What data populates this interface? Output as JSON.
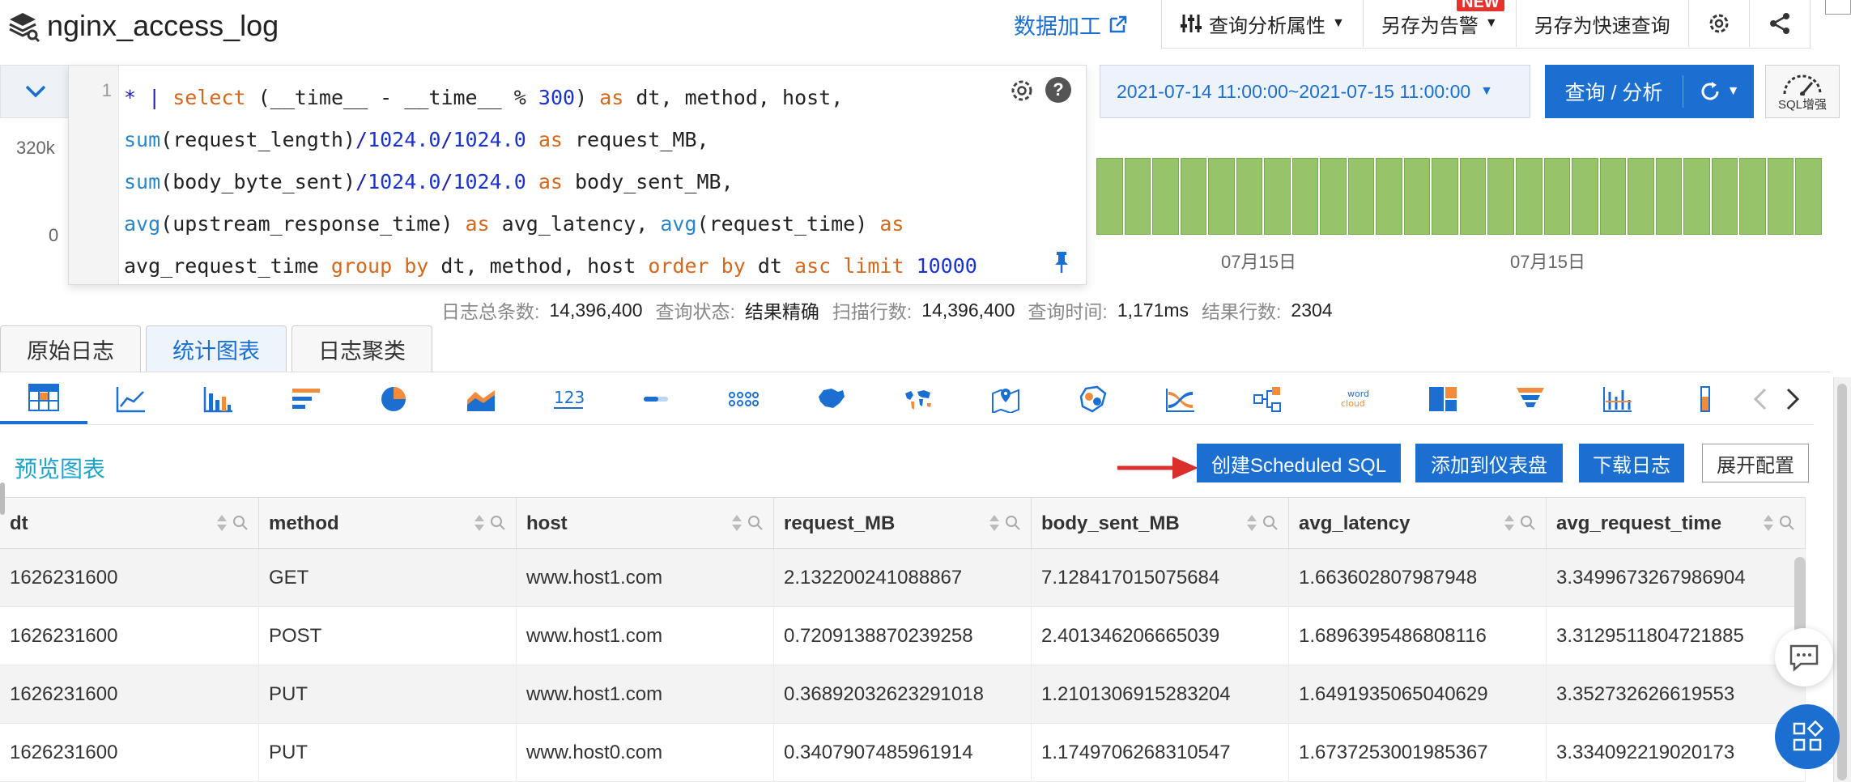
{
  "header": {
    "logstore_name": "nginx_access_log",
    "data_process_label": "数据加工",
    "toolbar": {
      "query_props_label": "查询分析属性",
      "save_alert_label": "另存为告警",
      "new_badge": "NEW",
      "save_quick_query_label": "另存为快速查询"
    }
  },
  "query": {
    "line_number": "1",
    "code_lines": [
      "* | select (__time__ - __time__ % 300) as dt, method, host,",
      "sum(request_length)/1024.0/1024.0 as request_MB,",
      "sum(body_byte_sent)/1024.0/1024.0 as body_sent_MB,",
      "avg(upstream_response_time) as avg_latency, avg(request_time) as",
      "avg_request_time group by dt, method, host order by dt asc limit 10000"
    ],
    "help_label": "?",
    "time_range": "2021-07-14 11:00:00~2021-07-15 11:00:00",
    "query_button_label": "查询 / 分析",
    "sql_boost_label": "SQL增强"
  },
  "histogram": {
    "y_max_label": "320k",
    "y_min_label": "0",
    "x_labels": [
      "07月15日",
      "07月15日"
    ],
    "bar_levels": [
      0.95,
      0.95,
      0.95,
      0.95,
      0.95,
      0.95,
      0.95,
      0.95,
      0.95,
      0.95,
      0.95,
      0.95,
      0.95,
      0.95,
      0.95,
      0.95,
      0.95,
      0.95,
      0.95,
      0.95,
      0.95,
      0.95,
      0.95,
      0.95,
      0.95,
      0.95
    ]
  },
  "stats": {
    "total_logs_label": "日志总条数:",
    "total_logs_value": "14,396,400",
    "query_status_label": "查询状态:",
    "query_status_value": "结果精确",
    "scanned_rows_label": "扫描行数:",
    "scanned_rows_value": "14,396,400",
    "query_time_label": "查询时间:",
    "query_time_value": "1,171ms",
    "result_rows_label": "结果行数:",
    "result_rows_value": "2304"
  },
  "tabs": [
    {
      "label": "原始日志"
    },
    {
      "label": "统计图表"
    },
    {
      "label": "日志聚类"
    }
  ],
  "chart_types": [
    "table-chart-icon",
    "line-chart-icon",
    "bar-chart-icon",
    "horizontal-bar-icon",
    "pie-chart-icon",
    "area-chart-icon",
    "single-value-icon",
    "progress-bar-icon",
    "flow-chart-icon",
    "china-map-icon",
    "world-map-icon",
    "amap-icon",
    "heat-map-icon",
    "sankey-icon",
    "topology-icon",
    "word-cloud-icon",
    "treemap-icon",
    "funnel-icon",
    "timeline-icon",
    "vertical-bar-icon"
  ],
  "chart_type_texts": {
    "single_value": "123",
    "word_cloud_a": "word",
    "word_cloud_b": "cloud"
  },
  "actions": {
    "preview_label": "预览图表",
    "create_scheduled_sql": "创建Scheduled SQL",
    "add_to_dashboard": "添加到仪表盘",
    "download_logs": "下载日志",
    "expand_config": "展开配置"
  },
  "table": {
    "columns": [
      "dt",
      "method",
      "host",
      "request_MB",
      "body_sent_MB",
      "avg_latency",
      "avg_request_time"
    ],
    "rows": [
      [
        "1626231600",
        "GET",
        "www.host1.com",
        "2.132200241088867",
        "7.128417015075684",
        "1.663602807987948",
        "3.3499673267986904"
      ],
      [
        "1626231600",
        "POST",
        "www.host1.com",
        "0.7209138870239258",
        "2.401346206665039",
        "1.6896395486808116",
        "3.3129511804721885"
      ],
      [
        "1626231600",
        "PUT",
        "www.host1.com",
        "0.36892032623291018",
        "1.2101306915283204",
        "1.6491935065040629",
        "3.352732626619553"
      ],
      [
        "1626231600",
        "PUT",
        "www.host0.com",
        "0.3407907485961914",
        "1.1749706268310547",
        "1.6737253001985367",
        "3.334092219020173"
      ]
    ]
  },
  "colors": {
    "accent": "#1a6fd1",
    "histogram_bar": "#97c46b",
    "preview_label": "#1fa3c9",
    "arrow": "#d9302c",
    "new_badge": "#e5322d"
  }
}
